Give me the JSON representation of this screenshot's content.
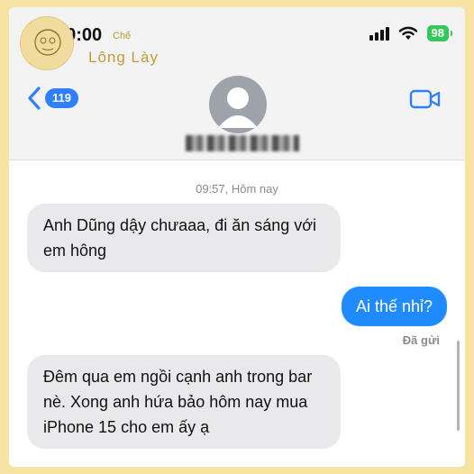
{
  "status_bar": {
    "time": "10:00",
    "battery": "98"
  },
  "watermark": {
    "small": "Chế",
    "name": "Lông Lày"
  },
  "nav": {
    "back_count": "119"
  },
  "thread": {
    "timestamp": "09:57, Hôm nay",
    "messages": [
      {
        "direction": "incoming",
        "text": "Anh Dũng dậy chưaaa, đi ăn sáng với em hông"
      },
      {
        "direction": "outgoing",
        "text": "Ai thế nhỉ?"
      },
      {
        "direction": "incoming",
        "text": "Đêm qua em ngồi cạnh anh trong bar nè. Xong anh hứa bảo hôm nay mua iPhone 15 cho em ấy ạ"
      }
    ],
    "delivery_status": "Đã gửi"
  },
  "colors": {
    "accent": "#1f8bff",
    "battery": "#34c759",
    "incoming_bubble": "#e9e9eb",
    "frame": "#f6e3a3"
  },
  "icons": [
    "back-chevron-icon",
    "contact-avatar-icon",
    "video-call-icon",
    "signal-icon",
    "wifi-icon",
    "battery-icon"
  ]
}
